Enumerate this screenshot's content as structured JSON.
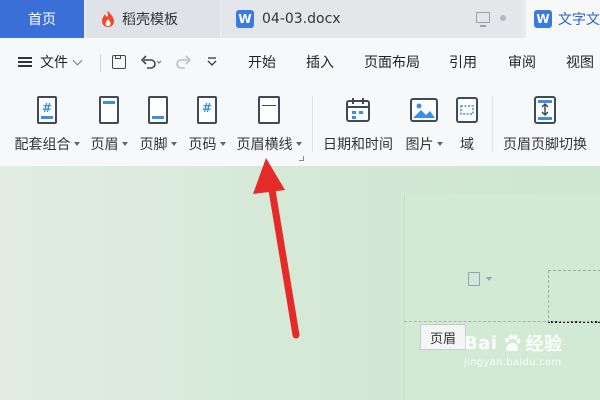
{
  "tabs": {
    "home": "首页",
    "template": "稻壳模板",
    "document": "04-03.docx",
    "writer": "文字文",
    "writer_logo": "W"
  },
  "menu": {
    "file": "文件",
    "items": [
      "开始",
      "插入",
      "页面布局",
      "引用",
      "审阅",
      "视图"
    ]
  },
  "ribbon": {
    "buttons": [
      {
        "label": "配套组合",
        "icon": "page-combo-icon"
      },
      {
        "label": "页眉",
        "icon": "header-icon"
      },
      {
        "label": "页脚",
        "icon": "footer-icon"
      },
      {
        "label": "页码",
        "icon": "page-number-icon"
      },
      {
        "label": "页眉横线",
        "icon": "header-line-icon"
      },
      {
        "label": "日期和时间",
        "icon": "calendar-icon"
      },
      {
        "label": "图片",
        "icon": "picture-icon"
      },
      {
        "label": "域",
        "icon": "field-icon"
      },
      {
        "label": "页眉页脚切换",
        "icon": "switch-header-footer-icon"
      }
    ]
  },
  "document": {
    "header_tag": "页眉"
  },
  "watermark": {
    "brand_left": "Bai",
    "brand_right": "经验",
    "url": "jingyan.baidu.com"
  },
  "colors": {
    "accent": "#3b6fd8",
    "arrow": "#e52a2a",
    "doc_background": "#d2ead3"
  }
}
